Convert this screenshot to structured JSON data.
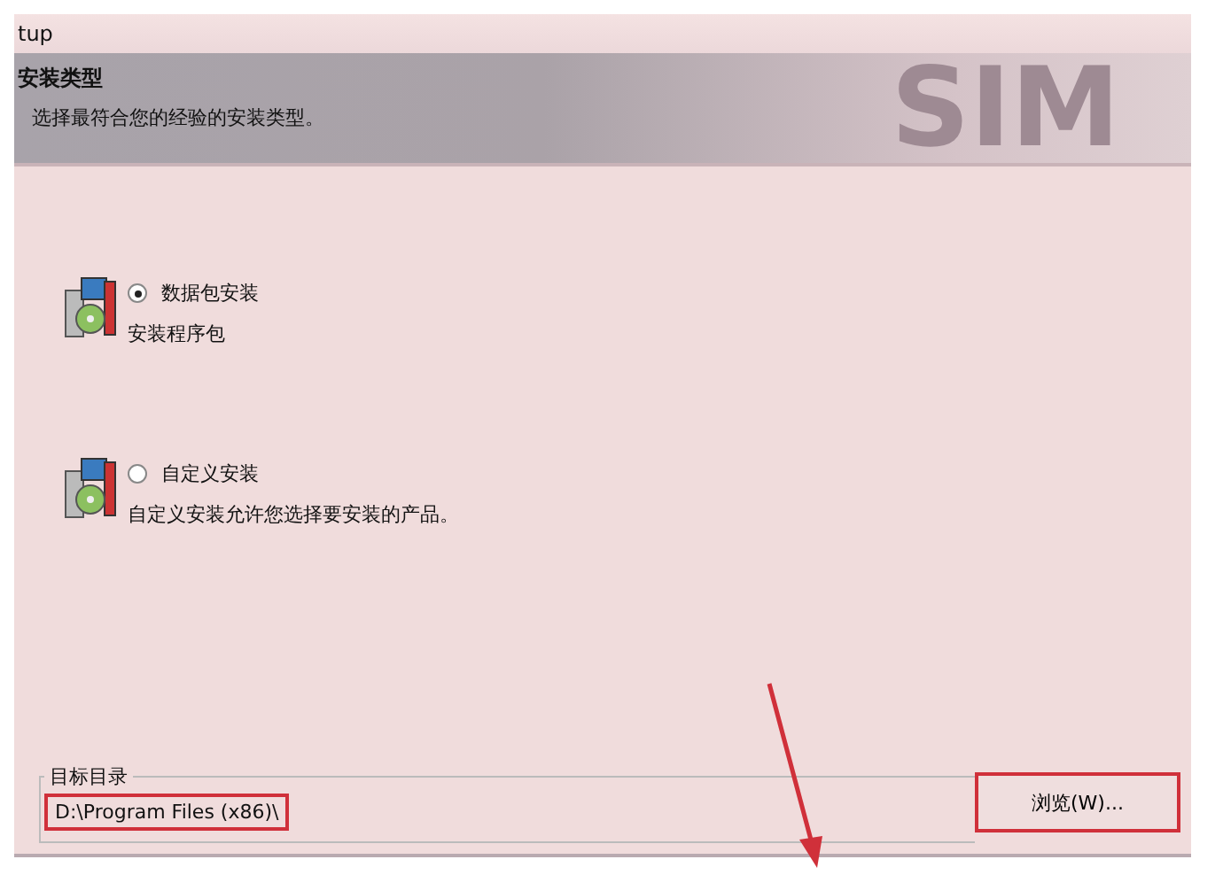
{
  "window": {
    "title": "tup"
  },
  "header": {
    "title": "安装类型",
    "subtitle": "选择最符合您的经验的安装类型。",
    "logo": "SIM"
  },
  "options": [
    {
      "label": "数据包安装",
      "description": "安装程序包",
      "selected": true
    },
    {
      "label": "自定义安装",
      "description": "自定义安装允许您选择要安装的产品。",
      "selected": false
    }
  ],
  "target": {
    "legend": "目标目录",
    "path": "D:\\Program Files (x86)\\",
    "highlighted": true
  },
  "browse_button": {
    "label": "浏览(W)...",
    "highlighted": true
  }
}
